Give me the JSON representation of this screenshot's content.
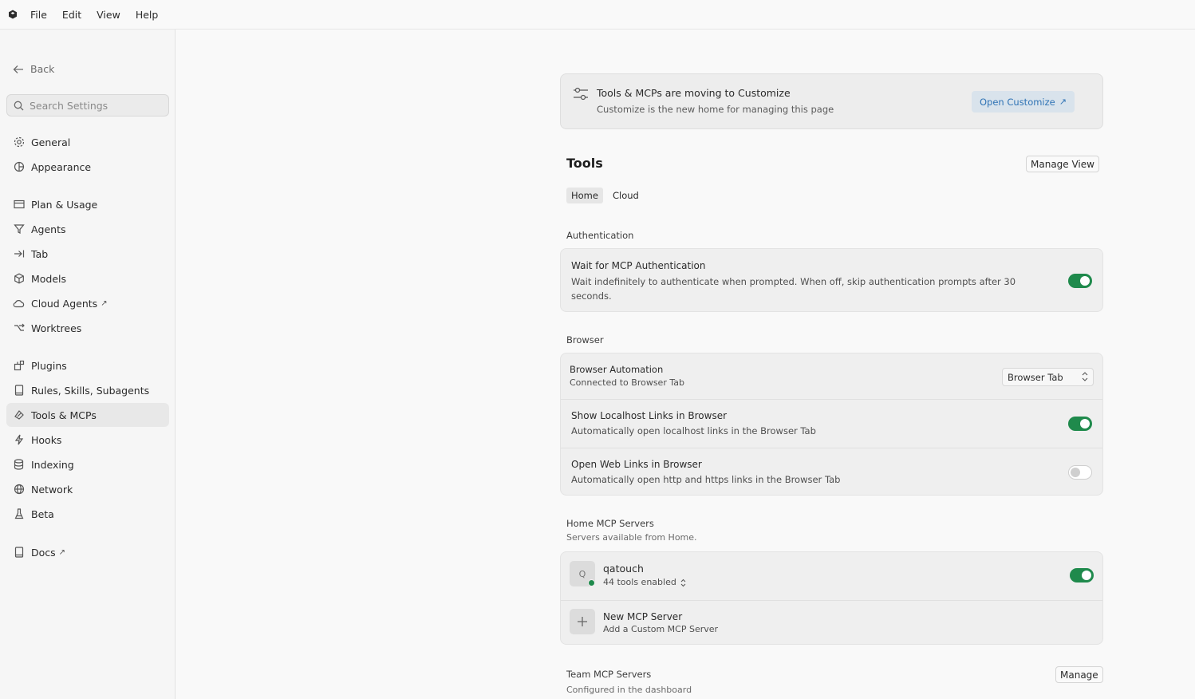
{
  "menu": {
    "items": [
      "File",
      "Edit",
      "View",
      "Help"
    ]
  },
  "sidebar": {
    "back_label": "Back",
    "search_placeholder": "Search Settings",
    "items": [
      {
        "label": "General",
        "icon": "gear-icon"
      },
      {
        "label": "Appearance",
        "icon": "palette-icon"
      },
      {
        "label": "Plan & Usage",
        "icon": "card-icon"
      },
      {
        "label": "Agents",
        "icon": "funnel-icon"
      },
      {
        "label": "Tab",
        "icon": "tab-arrow-icon"
      },
      {
        "label": "Models",
        "icon": "cube-icon"
      },
      {
        "label": "Cloud Agents",
        "icon": "cloud-icon",
        "external": "↗"
      },
      {
        "label": "Worktrees",
        "icon": "branch-icon"
      },
      {
        "label": "Plugins",
        "icon": "plugin-icon"
      },
      {
        "label": "Rules, Skills, Subagents",
        "icon": "book-icon"
      },
      {
        "label": "Tools & MCPs",
        "icon": "tools-icon",
        "active": true
      },
      {
        "label": "Hooks",
        "icon": "bolt-icon"
      },
      {
        "label": "Indexing",
        "icon": "database-icon"
      },
      {
        "label": "Network",
        "icon": "globe-icon"
      },
      {
        "label": "Beta",
        "icon": "flask-icon"
      },
      {
        "label": "Docs",
        "icon": "doc-icon",
        "external": "↗"
      }
    ]
  },
  "banner": {
    "title": "Tools & MCPs are moving to Customize",
    "subtitle": "Customize is the new home for managing this page",
    "button": "Open Customize",
    "button_arrow": "↗"
  },
  "page": {
    "title": "Tools",
    "manage_view": "Manage View",
    "tabs": [
      "Home",
      "Cloud"
    ]
  },
  "authentication": {
    "label": "Authentication",
    "title": "Wait for MCP Authentication",
    "desc_line1": "Wait indefinitely to authenticate when prompted. When off, skip authentication prompts after 30",
    "desc_line2": "seconds.",
    "enabled": true
  },
  "browser": {
    "label": "Browser",
    "automation_title": "Browser Automation",
    "automation_desc": "Connected to Browser Tab",
    "automation_value": "Browser Tab",
    "localhost_title": "Show Localhost Links in Browser",
    "localhost_desc": "Automatically open localhost links in the Browser Tab",
    "localhost_enabled": true,
    "web_title": "Open Web Links in Browser",
    "web_desc": "Automatically open http and https links in the Browser Tab",
    "web_enabled": false
  },
  "home_mcp": {
    "label": "Home MCP Servers",
    "sub": "Servers available from Home.",
    "server_name": "qatouch",
    "server_initial": "Q",
    "server_tools": "44 tools enabled",
    "server_enabled": true,
    "new_title": "New MCP Server",
    "new_desc": "Add a Custom MCP Server"
  },
  "team_mcp": {
    "label": "Team MCP Servers",
    "sub": "Configured in the dashboard",
    "manage": "Manage"
  },
  "colors": {
    "toggle_on": "#1f8a4c",
    "accent_blue": "#2f73b5"
  }
}
